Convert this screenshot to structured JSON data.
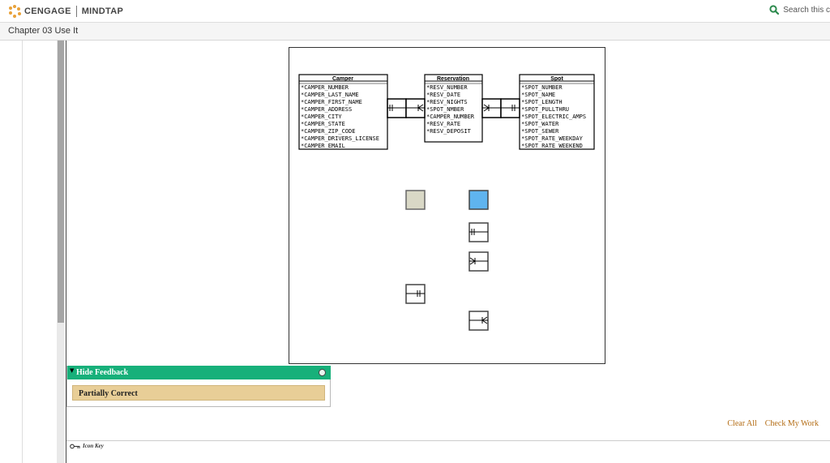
{
  "header": {
    "brand": "CENGAGE",
    "product": "MINDTAP",
    "search_label": "Search this c",
    "icons": {
      "search": "search-icon"
    },
    "colors": {
      "logo": "#e8a23a",
      "search": "#2d8a4e"
    }
  },
  "chapter": {
    "title": "Chapter 03 Use It"
  },
  "diagram": {
    "entities": [
      {
        "name": "Camper",
        "fields": [
          "*CAMPER_NUMBER",
          "*CAMPER_LAST_NAME",
          "*CAMPER_FIRST_NAME",
          "*CAMPER_ADDRESS",
          "*CAMPER_CITY",
          "*CAMPER_STATE",
          "*CAMPER_ZIP_CODE",
          "*CAMPER_DRIVERS_LICENSE",
          "*CAMPER_EMAIL"
        ]
      },
      {
        "name": "Reservation",
        "fields": [
          "*RESV_NUMBER",
          "*RESV_DATE",
          "*RESV_NIGHTS",
          "*SPOT_NMBER",
          "*CAMPER_NUMBER",
          "*RESV_RATE",
          "*RESV_DEPOSIT"
        ]
      },
      {
        "name": "Spot",
        "fields": [
          "*SPOT_NUMBER",
          "*SPOT_NAME",
          "*SPOT_LENGTH",
          "*SPOT_PULLTHRU",
          "*SPOT_ELECTRIC_AMPS",
          "*SPOT_WATER",
          "*SPOT_SEWER",
          "*SPOT_RATE_WEEKDAY",
          "*SPOT_RATE_WEEKEND"
        ]
      }
    ],
    "palette": [
      {
        "name": "gray-swatch",
        "color": "#d9d8c6"
      },
      {
        "name": "blue-swatch",
        "color": "#5fb4ef"
      },
      {
        "name": "one-mandatory-connector",
        "symbol": "one-and-only-one"
      },
      {
        "name": "many-connector",
        "symbol": "one-or-many"
      },
      {
        "name": "one-mandatory-left-connector",
        "symbol": "one-and-only-one"
      },
      {
        "name": "many-right-connector",
        "symbol": "zero-or-many"
      }
    ]
  },
  "feedback": {
    "toggle_label": "Hide Feedback",
    "result": "Partially Correct",
    "colors": {
      "header": "#17b07a",
      "result_bg": "#e8ce97"
    }
  },
  "actions": {
    "clear_all": "Clear All",
    "check_work": "Check My Work"
  },
  "footer": {
    "icon_key": "Icon Key"
  }
}
